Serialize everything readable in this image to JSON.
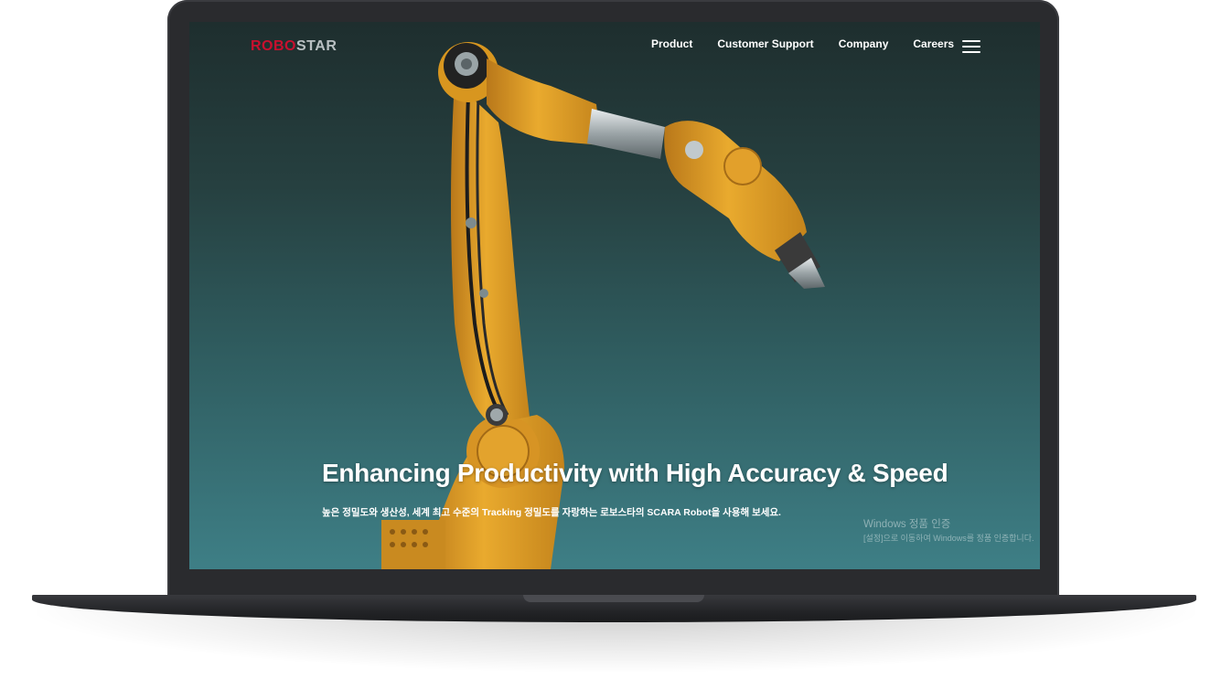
{
  "brand": {
    "logo_part1": "ROBO",
    "logo_part2": "STAR",
    "logo_color": "#c8102e"
  },
  "nav": {
    "items": [
      "Product",
      "Customer Support",
      "Company",
      "Careers"
    ],
    "menu_icon": "hamburger-menu-icon"
  },
  "hero": {
    "title": "Enhancing Productivity with High Accuracy & Speed",
    "subtitle": "높은 정밀도와 생산성, 세계 최고 수준의 Tracking 정밀도를 자랑하는 로보스타의 SCARA Robot을 사용해 보세요.",
    "image": "yellow-industrial-robot-arm"
  },
  "watermark": {
    "line1": "Windows 정품 인증",
    "line2": "[설정]으로 이동하여 Windows를 정품 인증합니다."
  },
  "colors": {
    "accent": "#c8102e",
    "robot": "#e0a12a",
    "background": "#2f5c5f"
  }
}
